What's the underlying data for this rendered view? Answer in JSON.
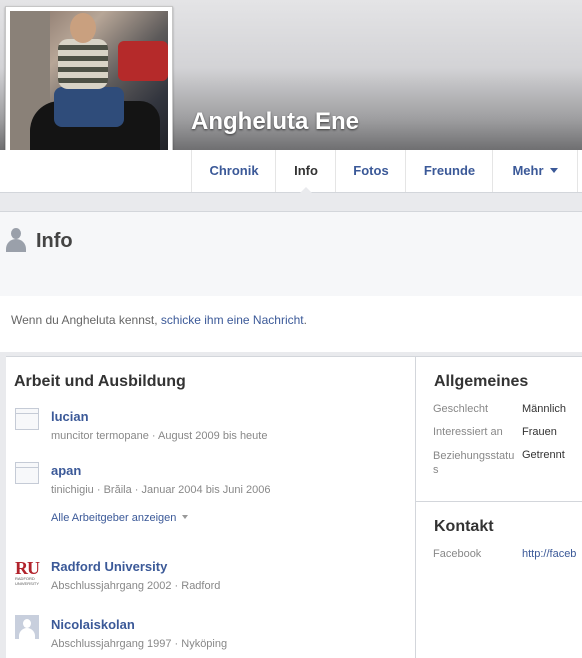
{
  "profile": {
    "name": "Angheluta Ene"
  },
  "tabs": [
    {
      "label": "Chronik"
    },
    {
      "label": "Info"
    },
    {
      "label": "Fotos"
    },
    {
      "label": "Freunde"
    },
    {
      "label": "Mehr"
    }
  ],
  "info_header": {
    "title": "Info"
  },
  "message": {
    "prefix": "Wenn du Angheluta kennst, ",
    "link": "schicke ihm eine Nachricht",
    "suffix": "."
  },
  "work_education": {
    "title": "Arbeit und Ausbildung",
    "jobs": [
      {
        "name": "lucian",
        "detail": "muncitor termopane · August 2009 bis heute"
      },
      {
        "name": "apan",
        "detail": "tinichigiu · Brăila · Januar 2004 bis Juni 2006"
      }
    ],
    "show_all_label": "Alle Arbeitgeber anzeigen",
    "schools": [
      {
        "name": "Radford University",
        "detail": "Abschlussjahrgang 2002 · Radford",
        "logo_text": "RU",
        "logo_subtext": "RADFORD UNIVERSITY"
      },
      {
        "name": "Nicolaiskolan",
        "detail": "Abschlussjahrgang 1997 · Nyköping"
      }
    ]
  },
  "general": {
    "title": "Allgemeines",
    "rows": [
      {
        "label": "Geschlecht",
        "value": "Männlich"
      },
      {
        "label": "Interessiert an",
        "value": "Frauen"
      },
      {
        "label": "Beziehungsstatus",
        "value": "Getrennt"
      }
    ]
  },
  "contact": {
    "title": "Kontakt",
    "rows": [
      {
        "label": "Facebook",
        "value": "http://faceb"
      }
    ]
  }
}
